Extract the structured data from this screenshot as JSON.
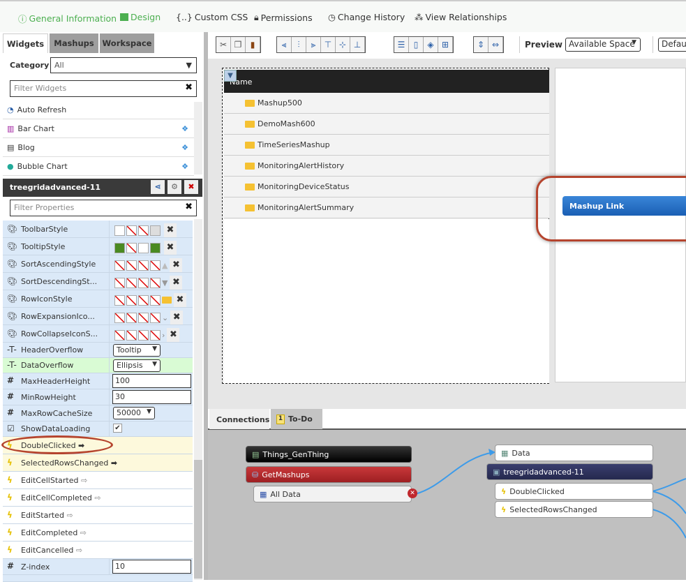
{
  "nav": {
    "items": [
      {
        "label": "General Information",
        "icon": "info-icon",
        "color": "#4caf50"
      },
      {
        "label": "Design",
        "icon": "design-icon",
        "color": "#4caf50"
      },
      {
        "label": "Custom CSS",
        "icon": "braces-icon"
      },
      {
        "label": "Permissions",
        "icon": "lock-icon"
      },
      {
        "label": "Change History",
        "icon": "clock-icon"
      },
      {
        "label": "View Relationships",
        "icon": "relationships-icon"
      }
    ]
  },
  "left": {
    "tabs": [
      "Widgets",
      "Mashups",
      "Workspace"
    ],
    "category_label": "Category",
    "category_value": "All",
    "filter_placeholder": "Filter Widgets",
    "widgets": [
      "Auto Refresh",
      "Bar Chart",
      "Blog",
      "Bubble Chart"
    ],
    "selected_widget": "treegridadvanced-11",
    "filter_props_placeholder": "Filter Properties",
    "style_props": [
      "ToolbarStyle",
      "TooltipStyle",
      "SortAscendingStyle",
      "SortDescendingSt...",
      "RowIconStyle",
      "RowExpansionIco...",
      "RowCollapseIconS..."
    ],
    "header_overflow": {
      "label": "HeaderOverflow",
      "value": "Tooltip"
    },
    "data_overflow": {
      "label": "DataOverflow",
      "value": "Ellipsis"
    },
    "max_header_height": {
      "label": "MaxHeaderHeight",
      "value": "100"
    },
    "min_row_height": {
      "label": "MinRowHeight",
      "value": "30"
    },
    "max_row_cache": {
      "label": "MaxRowCacheSize",
      "value": "50000"
    },
    "show_data_loading": {
      "label": "ShowDataLoading",
      "checked": true
    },
    "events": [
      {
        "label": "DoubleClicked",
        "bound": true
      },
      {
        "label": "SelectedRowsChanged",
        "bound": true
      },
      {
        "label": "EditCellStarted",
        "bound": false
      },
      {
        "label": "EditCellCompleted",
        "bound": false
      },
      {
        "label": "EditStarted",
        "bound": false
      },
      {
        "label": "EditCompleted",
        "bound": false
      },
      {
        "label": "EditCancelled",
        "bound": false
      }
    ],
    "zindex": {
      "label": "Z-index",
      "value": "10"
    }
  },
  "toolbar": {
    "preview_label": "Preview",
    "preview_value": "Available Space",
    "default_value": "Defaul"
  },
  "grid": {
    "header": "Name",
    "rows": [
      "Mashup500",
      "DemoMash600",
      "TimeSeriesMashup",
      "MonitoringAlertHistory",
      "MonitoringDeviceStatus",
      "MonitoringAlertSummary"
    ]
  },
  "mashup_link": {
    "label": "Mashup Link"
  },
  "bottom": {
    "tabs": [
      "Connections",
      "To-Do"
    ],
    "todo_count": "1",
    "nodes": {
      "thing": "Things_GenThing",
      "service": "GetMashups",
      "output": "All Data",
      "data": "Data",
      "widget": "treegridadvanced-11",
      "event1": "DoubleClicked",
      "event2": "SelectedRowsChanged"
    }
  },
  "colors": {
    "accent": "#4caf50",
    "link": "#1a5fb4",
    "highlight": "#b5442e"
  }
}
